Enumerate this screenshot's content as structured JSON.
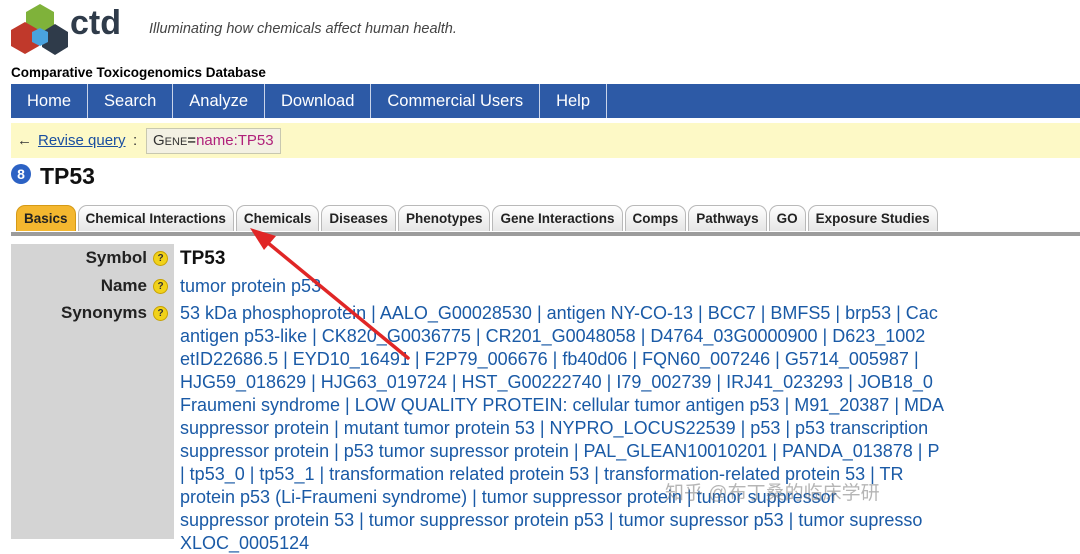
{
  "header": {
    "logo_text": "ctd",
    "tagline": "Illuminating how chemicals affect human health.",
    "site_title": "Comparative Toxicogenomics Database"
  },
  "nav": [
    "Home",
    "Search",
    "Analyze",
    "Download",
    "Commercial Users",
    "Help"
  ],
  "query": {
    "arrow": "←",
    "revise_label": "Revise query",
    "colon": ":",
    "field": "Gene",
    "equals": "=",
    "value": "name:TP53"
  },
  "gene": {
    "icon_glyph": "8",
    "symbol_title": "TP53"
  },
  "tabs": [
    "Basics",
    "Chemical Interactions",
    "Chemicals",
    "Diseases",
    "Phenotypes",
    "Gene Interactions",
    "Comps",
    "Pathways",
    "GO",
    "Exposure Studies"
  ],
  "active_tab": "Basics",
  "details": {
    "symbol_label": "Symbol",
    "symbol_value": "TP53",
    "name_label": "Name",
    "name_value": "tumor protein p53",
    "synonyms_label": "Synonyms",
    "help_glyph": "?",
    "synonym_lines": [
      "53 kDa phosphoprotein | AALO_G00028530 | antigen NY-CO-13 | BCC7 | BMFS5 | brp53 | Cac",
      "antigen p53-like | CK820_G0036775 | CR201_G0048058 | D4764_03G0000900 | D623_1002",
      "etID22686.5 | EYD10_16491 | F2P79_006676 | fb40d06 | FQN60_007246 | G5714_005987 |",
      "HJG59_018629 | HJG63_019724 | HST_G00222740 | I79_002739 | IRJ41_023293 | JOB18_0",
      "Fraumeni syndrome | LOW QUALITY PROTEIN: cellular tumor antigen p53 | M91_20387 | MDA",
      "suppressor protein | mutant tumor protein 53 | NYPRO_LOCUS22539 | p53 | p53 transcription",
      "suppressor protein | p53 tumor supressor protein | PAL_GLEAN10010201 | PANDA_013878 | P",
      "| tp53_0 | tp53_1 | transformation related protein 53 | transformation-related protein 53 | TR",
      "protein p53 (Li-Fraumeni syndrome) | tumor suppressor protein | tumor suppressor",
      "suppressor protein 53 | tumor suppressor protein p53 | tumor supressor p53 | tumor supresso",
      "XLOC_0005124"
    ]
  },
  "watermark": "知乎 @布丁桑的临床学研",
  "colors": {
    "nav_bg": "#2d5aa6",
    "query_bg": "#fdf9c6",
    "active_tab": "#f4b72f",
    "link_blue": "#1a5aa6",
    "annotation_red": "#e02626"
  }
}
